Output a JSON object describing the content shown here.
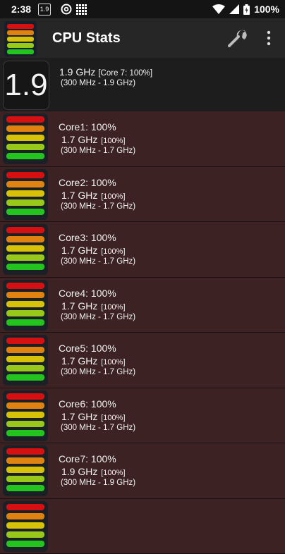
{
  "status_bar": {
    "time": "2:38",
    "mini_badge": "1.9",
    "battery_text": "100%",
    "icons": [
      "at-icon",
      "grid-icon",
      "wifi-icon",
      "signal-icon",
      "battery-icon"
    ]
  },
  "app_bar": {
    "title": "CPU Stats",
    "icons": [
      "app-logo-icon",
      "wrench-icon",
      "overflow-menu-icon"
    ]
  },
  "summary": {
    "big_value": "1.9",
    "freq": "1.9 GHz",
    "core_note": "[Core 7: 100%]",
    "range": "(300 MHz - 1.9 GHz)"
  },
  "cores": [
    {
      "name": "Core1: 100%",
      "freq": "1.7 GHz",
      "usage": "[100%]",
      "range": "(300 MHz - 1.7 GHz)"
    },
    {
      "name": "Core2: 100%",
      "freq": "1.7 GHz",
      "usage": "[100%]",
      "range": "(300 MHz - 1.7 GHz)"
    },
    {
      "name": "Core3: 100%",
      "freq": "1.7 GHz",
      "usage": "[100%]",
      "range": "(300 MHz - 1.7 GHz)"
    },
    {
      "name": "Core4: 100%",
      "freq": "1.7 GHz",
      "usage": "[100%]",
      "range": "(300 MHz - 1.7 GHz)"
    },
    {
      "name": "Core5: 100%",
      "freq": "1.7 GHz",
      "usage": "[100%]",
      "range": "(300 MHz - 1.7 GHz)"
    },
    {
      "name": "Core6: 100%",
      "freq": "1.7 GHz",
      "usage": "[100%]",
      "range": "(300 MHz - 1.7 GHz)"
    },
    {
      "name": "Core7: 100%",
      "freq": "1.9 GHz",
      "usage": "[100%]",
      "range": "(300 MHz - 1.9 GHz)"
    }
  ],
  "colors": {
    "row_bg": "#3c2222",
    "bar_red": "#d61010",
    "bar_orange": "#e0820f",
    "bar_yellow": "#d8c208",
    "bar_lime": "#98c81a",
    "bar_green": "#22c41d"
  },
  "meter_level": 1.0
}
